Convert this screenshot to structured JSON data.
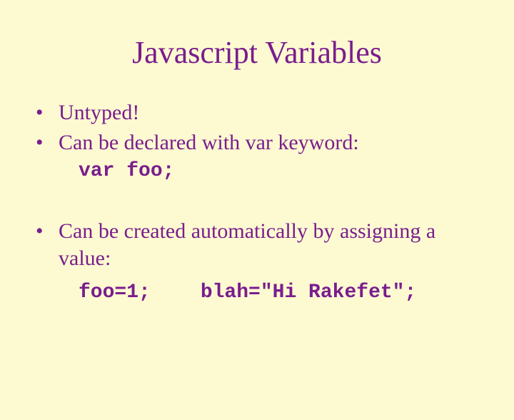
{
  "title": "Javascript Variables",
  "bullets": {
    "b1": "Untyped!",
    "b2": "Can be declared with var keyword:",
    "b3": "Can be created automatically by assigning a value:"
  },
  "code": {
    "c1": "var foo;",
    "c2a": "foo=1;",
    "c2b": "blah=\"Hi Rakefet\";"
  }
}
